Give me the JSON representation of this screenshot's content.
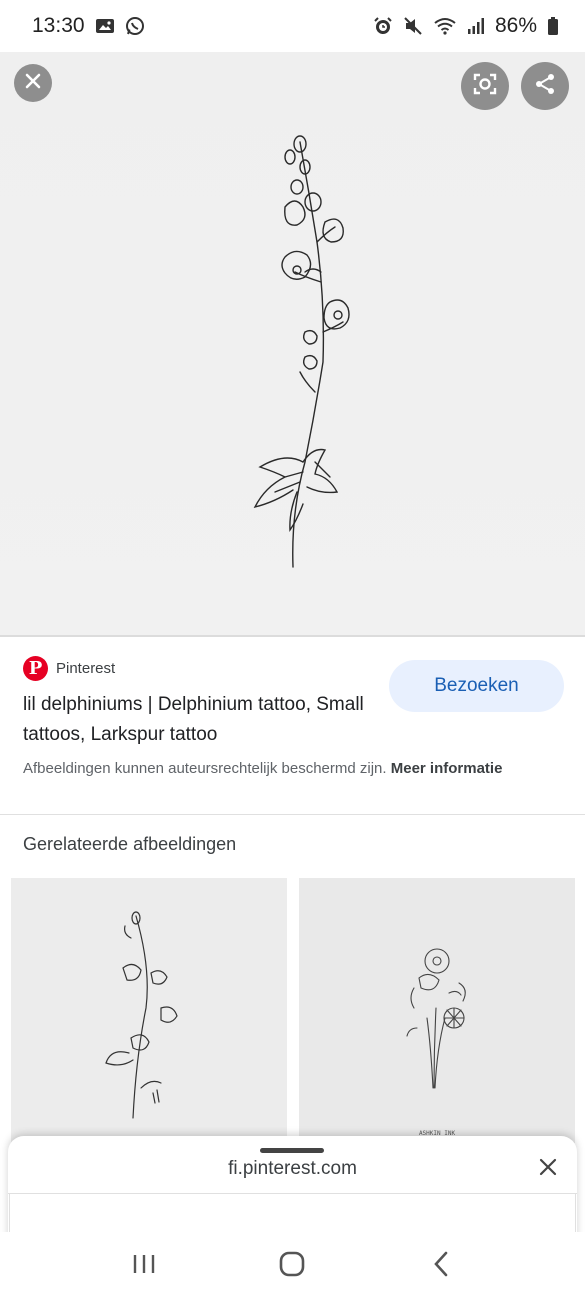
{
  "status_bar": {
    "time": "13:30",
    "battery": "86%",
    "icons_left": [
      "gallery-icon",
      "whatsapp-icon"
    ],
    "icons_right": [
      "alarm-icon",
      "mute-icon",
      "wifi-icon",
      "signal-icon",
      "battery-icon"
    ]
  },
  "viewer": {
    "close_icon": "close-icon",
    "lens_icon": "lens-icon",
    "share_icon": "share-icon"
  },
  "result": {
    "source": "Pinterest",
    "title": "lil delphiniums | Delphinium tattoo, Small tattoos, Larkspur tattoo",
    "visit_label": "Bezoeken",
    "copyright_text": "Afbeeldingen kunnen auteursrechtelijk beschermd zijn.",
    "more_info": "Meer informatie"
  },
  "related": {
    "heading": "Gerelateerde afbeeldingen",
    "watermark": "ASHKIN INK"
  },
  "sheet": {
    "url": "fi.pinterest.com"
  },
  "navbar": {
    "recents_icon": "recents-icon",
    "home_icon": "home-icon",
    "back_icon": "back-icon"
  },
  "colors": {
    "accent": "#1a5fb4",
    "button_bg": "#e8f0fe",
    "pinterest_red": "#e60023"
  }
}
